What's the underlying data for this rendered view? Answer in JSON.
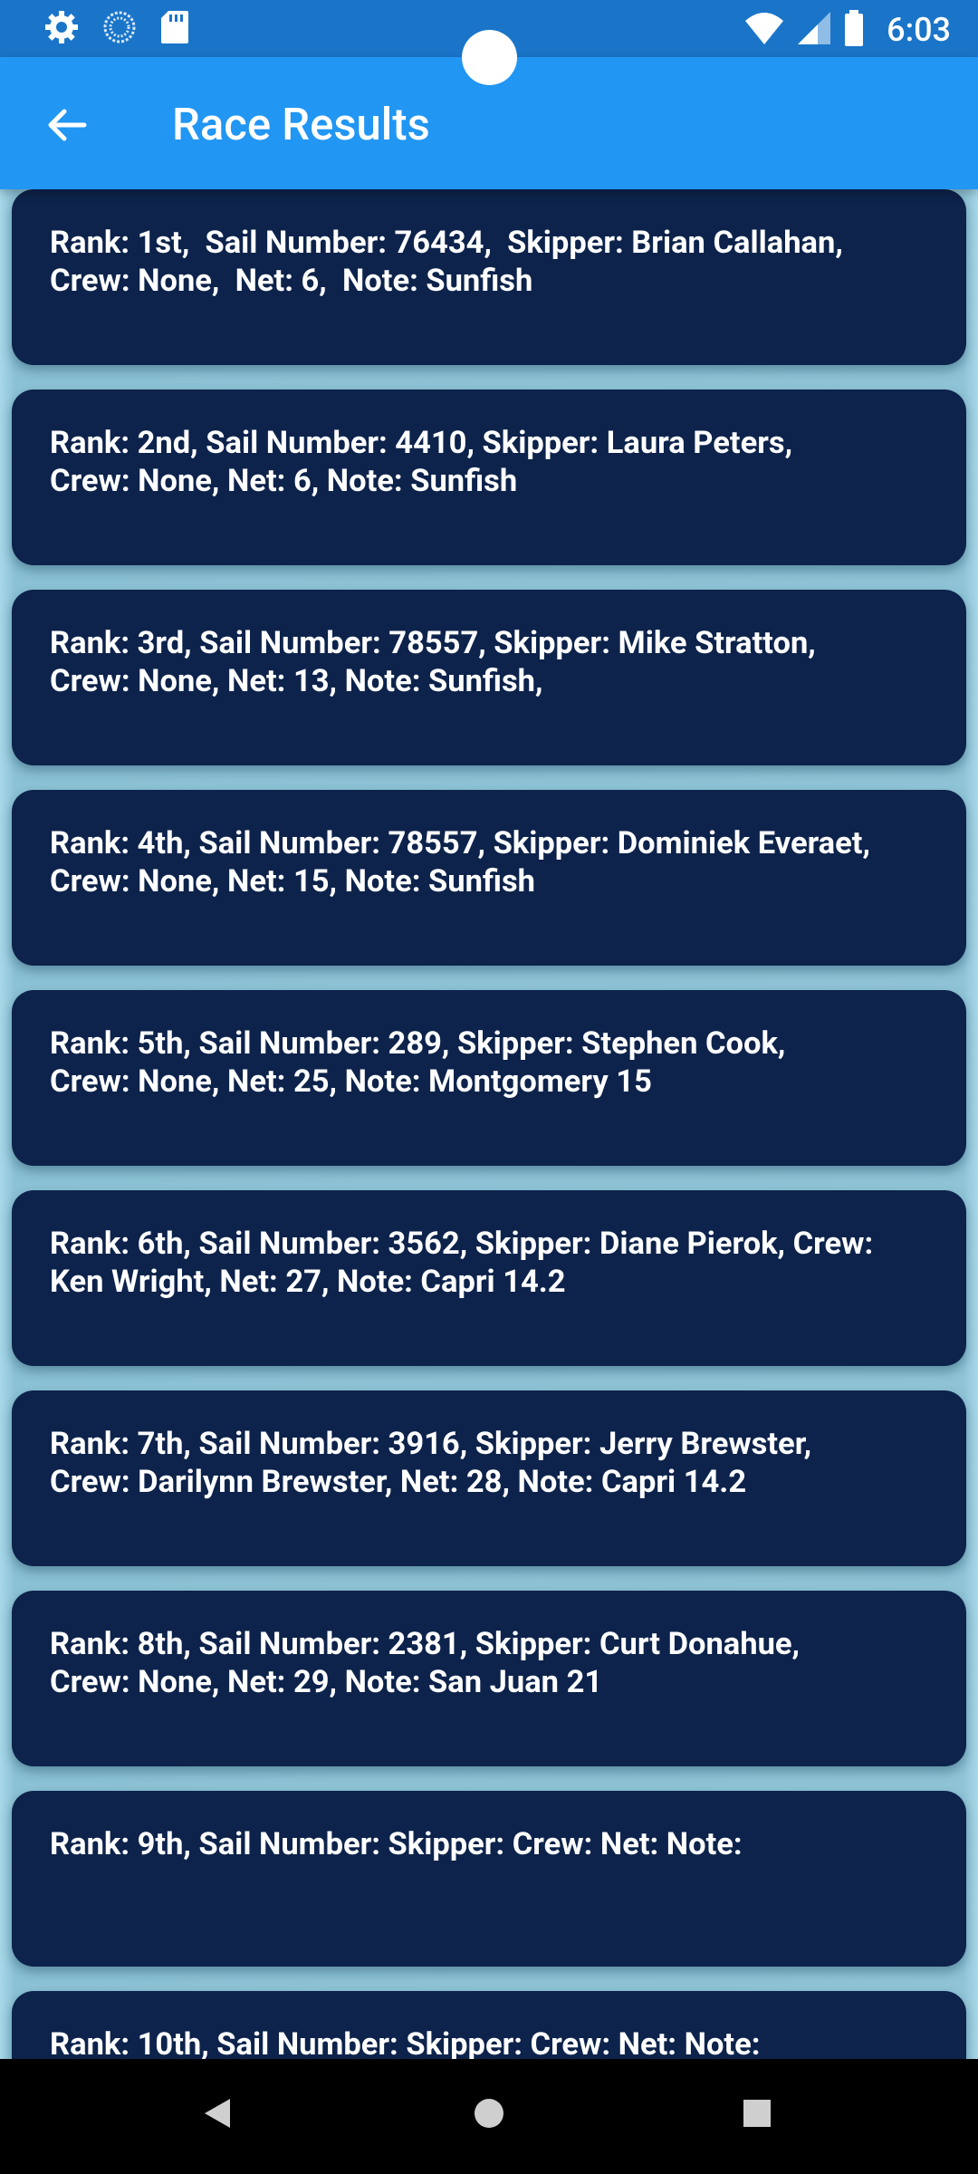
{
  "status_bar": {
    "time": "6:03",
    "icons": [
      "settings-icon",
      "sync-icon",
      "sd-card-icon",
      "wifi-icon",
      "cell-signal-icon",
      "battery-icon"
    ]
  },
  "app_bar": {
    "title": "Race Results",
    "back_icon": "arrow-back-icon"
  },
  "colors": {
    "status_bar": "#1a75c9",
    "app_bar": "#2196f3",
    "card": "#0d234b",
    "background": "#8cc7db"
  },
  "results": [
    {
      "text": "Rank: 1st,  Sail Number: 76434,  Skipper: Brian Callahan,\nCrew: None,  Net: 6,  Note: Sunfish"
    },
    {
      "text": "Rank: 2nd, Sail Number: 4410, Skipper: Laura Peters,\nCrew: None, Net: 6, Note: Sunfish"
    },
    {
      "text": "Rank: 3rd, Sail Number: 78557, Skipper: Mike Stratton,\nCrew: None, Net: 13, Note: Sunfish,"
    },
    {
      "text": "Rank: 4th, Sail Number: 78557, Skipper: Dominiek Everaet,\nCrew: None, Net: 15, Note: Sunfish"
    },
    {
      "text": "Rank: 5th, Sail Number: 289, Skipper: Stephen Cook,\nCrew: None, Net: 25, Note: Montgomery 15"
    },
    {
      "text": "Rank: 6th, Sail Number: 3562, Skipper: Diane Pierok, Crew:\nKen Wright, Net: 27, Note: Capri 14.2"
    },
    {
      "text": "Rank: 7th, Sail Number: 3916, Skipper: Jerry Brewster,\nCrew: Darilynn Brewster, Net: 28, Note: Capri 14.2"
    },
    {
      "text": "Rank: 8th, Sail Number: 2381, Skipper: Curt Donahue,\nCrew: None, Net: 29, Note: San Juan 21"
    },
    {
      "text": "Rank: 9th, Sail Number: Skipper: Crew: Net: Note:"
    },
    {
      "text": "Rank: 10th, Sail Number: Skipper: Crew: Net: Note:"
    }
  ],
  "nav_bar": {
    "icons": [
      "back-triangle-icon",
      "home-circle-icon",
      "recents-square-icon"
    ]
  }
}
